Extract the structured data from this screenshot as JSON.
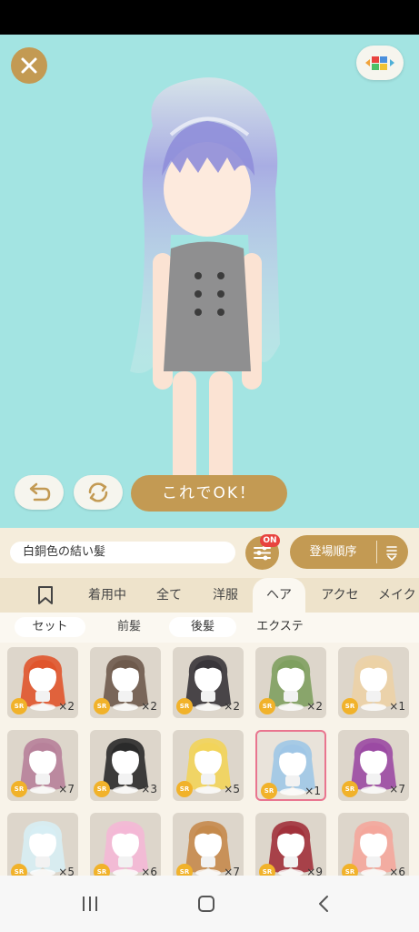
{
  "app": {
    "accent": "#c39a53",
    "stage_bg": "#a3e4e2"
  },
  "stage": {
    "close_icon": "close-icon",
    "palette_icon": "palette-icon",
    "ok_label": "これでOK！"
  },
  "info": {
    "item_name": "白銅色の結い髪",
    "filter_badge": "ON",
    "sort_label": "登場順序"
  },
  "tabs": [
    {
      "label": "着用中"
    },
    {
      "label": "全て"
    },
    {
      "label": "洋服"
    },
    {
      "label": "ヘア",
      "active": true
    },
    {
      "label": "アクセ"
    },
    {
      "label": "メイク"
    }
  ],
  "subtabs": [
    {
      "label": "セット"
    },
    {
      "label": "前髪",
      "active": true
    },
    {
      "label": "後髪"
    },
    {
      "label": "エクステ"
    }
  ],
  "items": [
    {
      "rarity": "SR",
      "qty": "×2",
      "color": "#e0552c"
    },
    {
      "rarity": "SR",
      "qty": "×2",
      "color": "#6e5a4c"
    },
    {
      "rarity": "SR",
      "qty": "×2",
      "color": "#38353a"
    },
    {
      "rarity": "SR",
      "qty": "×2",
      "color": "#7fa060"
    },
    {
      "rarity": "SR",
      "qty": "×1",
      "color": "#ecd2a6"
    },
    {
      "rarity": "SR",
      "qty": "×7",
      "color": "#b7819a"
    },
    {
      "rarity": "SR",
      "qty": "×3",
      "color": "#2a2a2a"
    },
    {
      "rarity": "SR",
      "qty": "×5",
      "color": "#f2d45a"
    },
    {
      "rarity": "SR",
      "qty": "×1",
      "color": "#9fc6e6",
      "selected": true
    },
    {
      "rarity": "SR",
      "qty": "×7",
      "color": "#9b4aa3"
    },
    {
      "rarity": "SR",
      "qty": "×5",
      "color": "#d7eef4"
    },
    {
      "rarity": "SR",
      "qty": "×6",
      "color": "#f4b8d6"
    },
    {
      "rarity": "SR",
      "qty": "×7",
      "color": "#c58a4c"
    },
    {
      "rarity": "SR",
      "qty": "×9",
      "color": "#a1313b"
    },
    {
      "rarity": "SR",
      "qty": "×6",
      "color": "#f4a79c"
    }
  ]
}
